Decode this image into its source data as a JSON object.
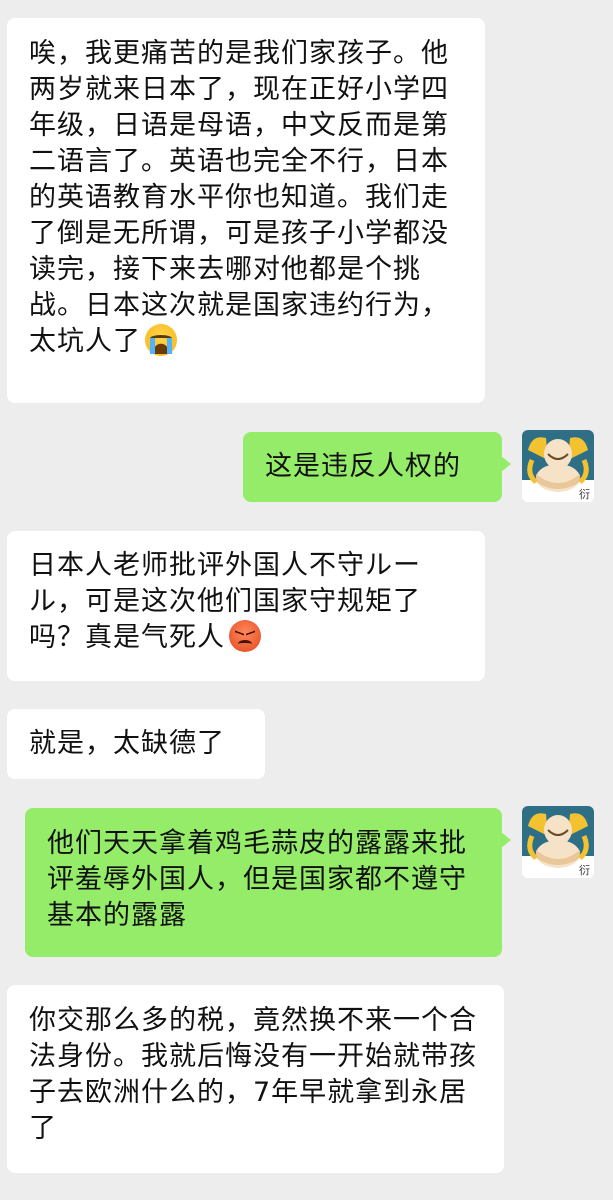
{
  "messages": [
    {
      "side": "incoming",
      "text": "唉，我更痛苦的是我们家孩子。他两岁就来日本了，现在正好小学四年级，日语是母语，中文反而是第二语言了。英语也完全不行，日本的英语教育水平你也知道。我们走了倒是无所谓，可是孩子小学都没读完，接下来去哪对他都是个挑战。日本这次就是国家违约行为，太坑人了",
      "emoji": "crying-face"
    },
    {
      "side": "outgoing",
      "text": "这是违反人权的"
    },
    {
      "side": "incoming",
      "text": "日本人老师批评外国人不守ルール，可是这次他们国家守规矩了吗？真是气死人",
      "emoji": "angry-face"
    },
    {
      "side": "incoming",
      "text": "就是，太缺德了"
    },
    {
      "side": "outgoing",
      "text": "他们天天拿着鸡毛蒜皮的露露来批评羞辱外国人，但是国家都不遵守基本的露露"
    },
    {
      "side": "incoming",
      "text": "你交那么多的税，竟然换不来一个合法身份。我就后悔没有一开始就带孩子去欧洲什么的，7年早就拿到永居了"
    }
  ],
  "avatar": {
    "caption": "衍",
    "icon": "laughing-buddha-avatar"
  },
  "colors": {
    "background": "#ededed",
    "incoming_bubble": "#ffffff",
    "outgoing_bubble": "#95ec69"
  }
}
